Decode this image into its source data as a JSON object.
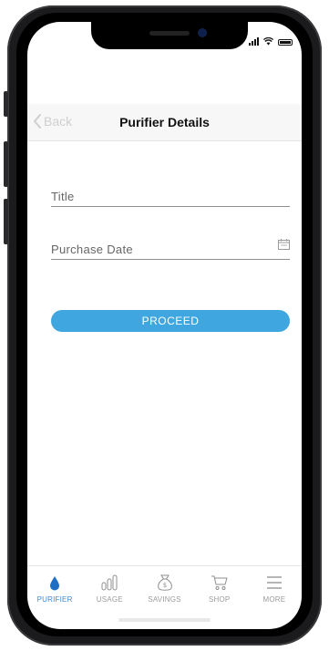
{
  "colors": {
    "accent": "#3fa6df",
    "active_tab": "#3a8ad6",
    "inactive_tab": "#9b9b9b"
  },
  "navbar": {
    "back_label": "Back",
    "title": "Purifier Details"
  },
  "form": {
    "title_placeholder": "Title",
    "purchase_date_placeholder": "Purchase Date",
    "proceed_label": "PROCEED"
  },
  "tabs": [
    {
      "label": "PURIFIER",
      "icon": "water-drop-icon",
      "active": true
    },
    {
      "label": "USAGE",
      "icon": "bar-chart-icon",
      "active": false
    },
    {
      "label": "SAVINGS",
      "icon": "money-bag-icon",
      "active": false
    },
    {
      "label": "SHOP",
      "icon": "shopping-cart-icon",
      "active": false
    },
    {
      "label": "MORE",
      "icon": "menu-icon",
      "active": false
    }
  ]
}
